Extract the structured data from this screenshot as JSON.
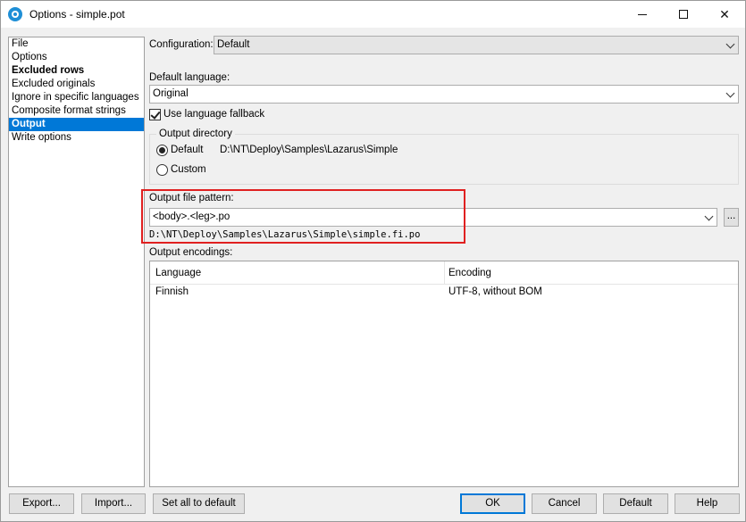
{
  "window": {
    "title": "Options - simple.pot"
  },
  "sidebar": {
    "items": [
      {
        "label": "File",
        "style": "normal"
      },
      {
        "label": "Options",
        "style": "normal"
      },
      {
        "label": "Excluded rows",
        "style": "bold"
      },
      {
        "label": "Excluded originals",
        "style": "normal"
      },
      {
        "label": "Ignore in specific languages",
        "style": "normal"
      },
      {
        "label": "Composite format strings",
        "style": "normal"
      },
      {
        "label": "Output",
        "style": "selected"
      },
      {
        "label": "Write options",
        "style": "normal"
      }
    ]
  },
  "configuration": {
    "label": "Configuration:",
    "value": "Default"
  },
  "default_language": {
    "label": "Default language:",
    "value": "Original"
  },
  "fallback": {
    "label": "Use language fallback",
    "checked": true
  },
  "output_directory": {
    "title": "Output directory",
    "default_label": "Default",
    "default_path": "D:\\NT\\Deploy\\Samples\\Lazarus\\Simple",
    "custom_label": "Custom",
    "selected": "Default"
  },
  "output_pattern": {
    "label": "Output file pattern:",
    "value": "<body>.<leg>.po",
    "browse_label": "...",
    "resolved_path": "D:\\NT\\Deploy\\Samples\\Lazarus\\Simple\\simple.fi.po"
  },
  "output_encodings": {
    "label": "Output encodings:",
    "columns": [
      "Language",
      "Encoding"
    ],
    "rows": [
      {
        "language": "Finnish",
        "encoding": "UTF-8, without BOM"
      }
    ]
  },
  "buttons": {
    "export": "Export...",
    "import": "Import...",
    "set_all_default": "Set all to default",
    "ok": "OK",
    "cancel": "Cancel",
    "default": "Default",
    "help": "Help"
  },
  "colors": {
    "selection": "#0078d7",
    "highlight_box": "#e02020"
  }
}
